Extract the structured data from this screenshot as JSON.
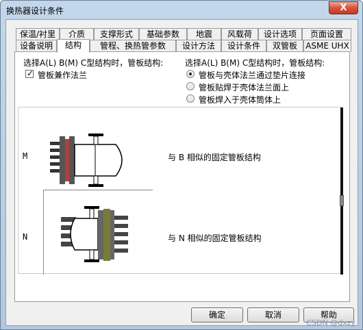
{
  "window": {
    "title": "换热器设计条件",
    "close_label": "X"
  },
  "tabs_row1": [
    "保温/衬里",
    "介质",
    "支撑形式",
    "基础参数",
    "地震",
    "风载荷",
    "设计选项",
    "页面设置"
  ],
  "tabs_row2": [
    "设备说明",
    "结构",
    "管程、换热管参数",
    "设计方法",
    "设计条件",
    "双管板",
    "ASME UHX"
  ],
  "left_heading": "选择A(L) B(M) C型结构时，管板结构:",
  "checkbox_label": "管板兼作法兰",
  "right_heading": "选择A(L) B(M) C型结构时，管板结构:",
  "radios": [
    {
      "label": "管板与壳体法兰通过垫片连接",
      "selected": true
    },
    {
      "label": "管板贴焊于壳体法兰面上",
      "selected": false
    },
    {
      "label": "管板焊入于壳体筒体上",
      "selected": false
    }
  ],
  "rows": [
    {
      "code": "M",
      "description": "与 B 相似的固定管板结构"
    },
    {
      "code": "N",
      "description": "与 N 相似的固定管板结构"
    }
  ],
  "buttons": {
    "ok": "确定",
    "cancel": "取消",
    "help": "帮助"
  },
  "watermark": "CSDN @dxzy"
}
